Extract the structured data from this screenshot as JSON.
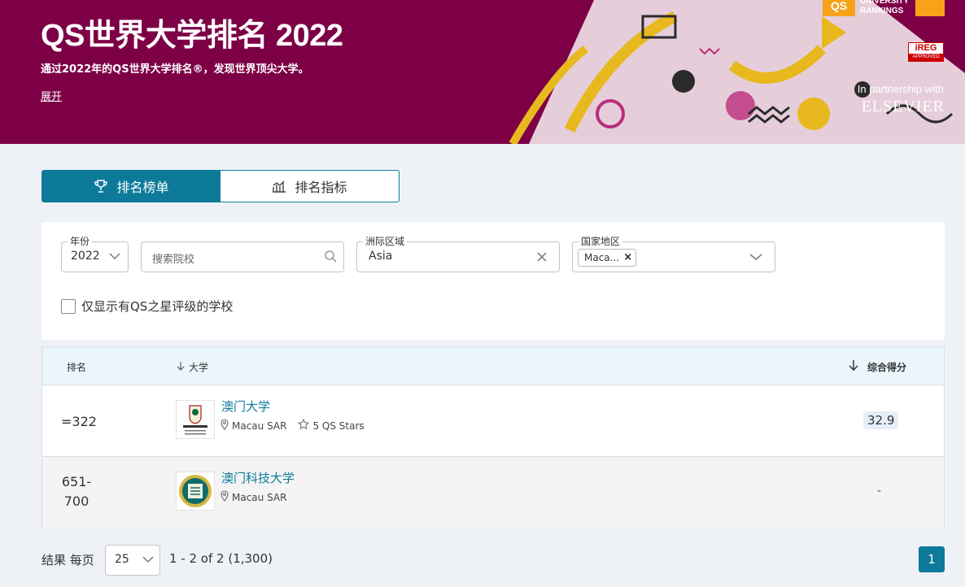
{
  "hero": {
    "title": "QS世界大学排名 2022",
    "subtitle": "通过2022年的QS世界大学排名®，发现世界顶尖大学。",
    "expand_link": "展开",
    "qs_logo_mark": "QS",
    "qs_logo_line1": "UNIVERSITY",
    "qs_logo_line2": "RANKINGS",
    "ireg_text": "iREG",
    "ireg_sub": "APPROVED",
    "partner_text": "In partnership with",
    "partner_name": "ELSEVIER",
    "background_color": "#7d0046"
  },
  "tabs": [
    {
      "label": "排名榜单",
      "icon": "trophy-icon",
      "active": true
    },
    {
      "label": "排名指标",
      "icon": "bar-chart-icon",
      "active": false
    }
  ],
  "filters": {
    "year": {
      "label": "年份",
      "value": "2022"
    },
    "search": {
      "placeholder": "搜索院校"
    },
    "region": {
      "label": "洲际区域",
      "value": "Asia"
    },
    "country": {
      "label": "国家地区",
      "chip": "Maca..."
    },
    "stars_only_label": "仅显示有QS之星评级的学校",
    "stars_only_checked": false
  },
  "table": {
    "headers": {
      "rank": "排名",
      "university": "大学",
      "score": "综合得分"
    },
    "rows": [
      {
        "rank": "=322",
        "name": "澳门大学",
        "location": "Macau SAR",
        "stars": "5 QS Stars",
        "score": "32.9",
        "logo": "university-of-macau-logo"
      },
      {
        "rank_line1": "651-",
        "rank_line2": "700",
        "name": "澳门科技大学",
        "location": "Macau SAR",
        "score": "-",
        "logo": "must-logo"
      }
    ]
  },
  "pagination": {
    "label": "结果 每页",
    "per_page": "25",
    "range": "1 - 2 of 2 (1,300)",
    "current_page": "1"
  },
  "colors": {
    "accent": "#0e7a9a",
    "hero": "#7d0046",
    "qs_orange": "#f8a21a"
  }
}
